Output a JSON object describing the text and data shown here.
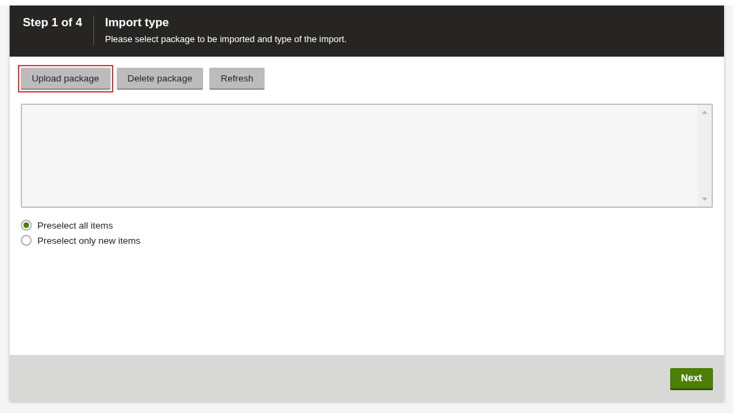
{
  "header": {
    "step": "Step 1 of 4",
    "title": "Import type",
    "description": "Please select package to be imported and type of the import."
  },
  "buttons": [
    {
      "label": "Upload package",
      "highlighted": true
    },
    {
      "label": "Delete package",
      "highlighted": false
    },
    {
      "label": "Refresh",
      "highlighted": false
    }
  ],
  "options": [
    {
      "label": "Preselect all items",
      "selected": true
    },
    {
      "label": "Preselect only new items",
      "selected": false
    }
  ],
  "footer": {
    "next": "Next"
  }
}
